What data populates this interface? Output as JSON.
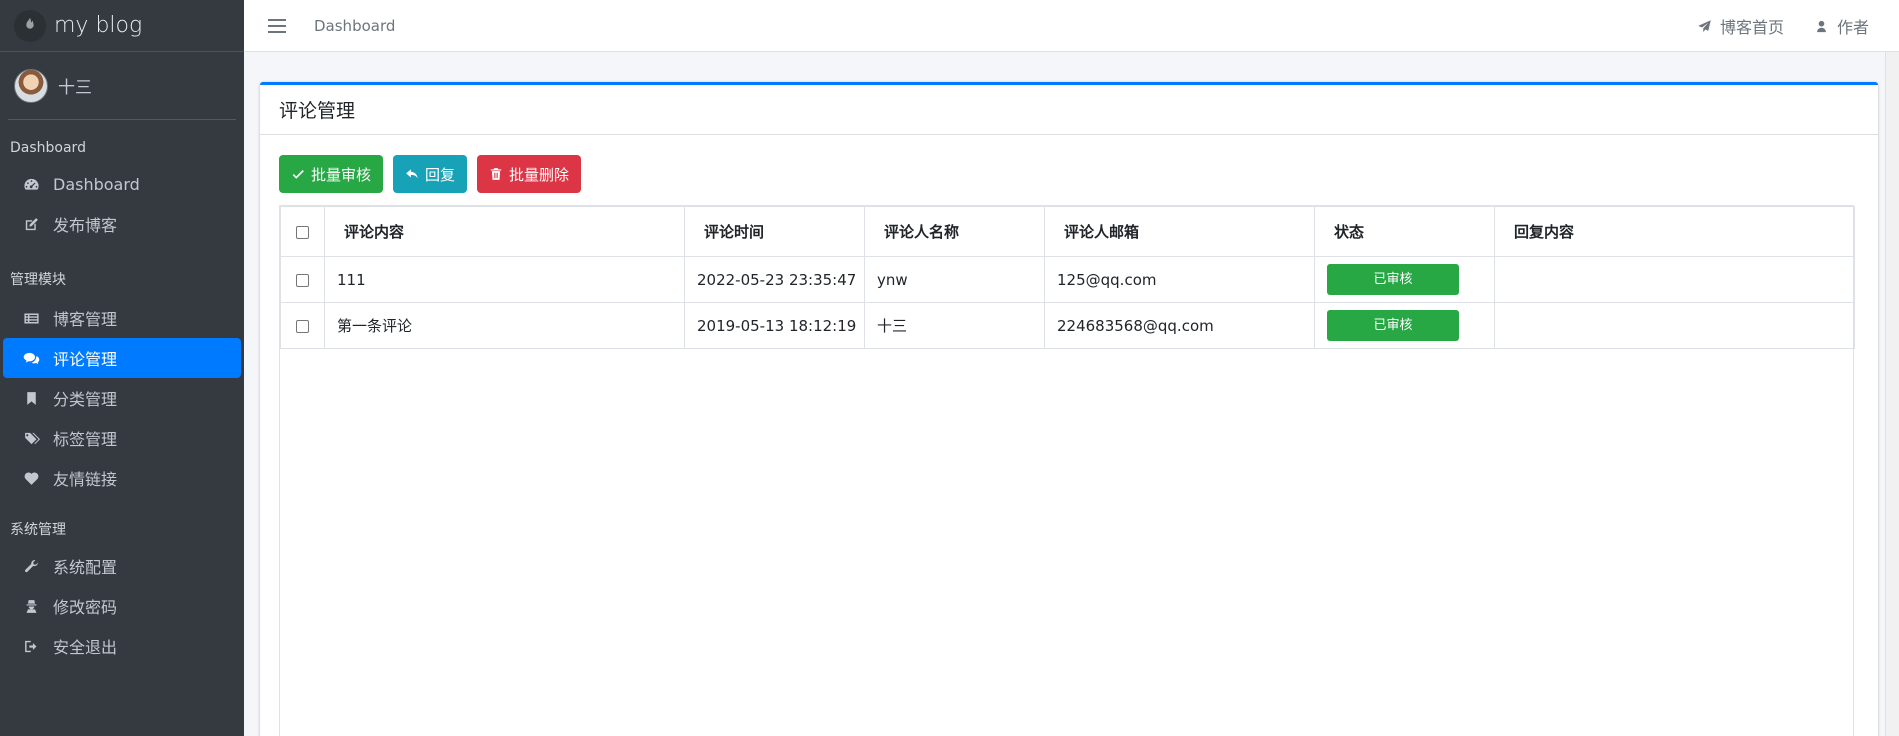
{
  "brand": {
    "name": "my blog"
  },
  "user": {
    "name": "十三"
  },
  "sidebar": {
    "sections": [
      {
        "header": "Dashboard",
        "items": [
          {
            "label": "Dashboard",
            "icon": "dashboard-icon"
          },
          {
            "label": "发布博客",
            "icon": "edit-icon"
          }
        ]
      },
      {
        "header": "管理模块",
        "items": [
          {
            "label": "博客管理",
            "icon": "list-icon"
          },
          {
            "label": "评论管理",
            "icon": "comments-icon",
            "active": true
          },
          {
            "label": "分类管理",
            "icon": "bookmark-icon"
          },
          {
            "label": "标签管理",
            "icon": "tags-icon"
          },
          {
            "label": "友情链接",
            "icon": "heart-icon"
          }
        ]
      },
      {
        "header": "系统管理",
        "items": [
          {
            "label": "系统配置",
            "icon": "wrench-icon"
          },
          {
            "label": "修改密码",
            "icon": "user-secret-icon"
          },
          {
            "label": "安全退出",
            "icon": "sign-out-icon"
          }
        ]
      }
    ]
  },
  "topbar": {
    "breadcrumb": "Dashboard",
    "links": [
      {
        "label": "博客首页",
        "icon": "paper-plane-icon"
      },
      {
        "label": "作者",
        "icon": "user-icon"
      }
    ]
  },
  "card": {
    "title": "评论管理",
    "buttons": {
      "approve": "批量审核",
      "reply": "回复",
      "delete": "批量删除"
    }
  },
  "table": {
    "headers": [
      "评论内容",
      "评论时间",
      "评论人名称",
      "评论人邮箱",
      "状态",
      "回复内容"
    ],
    "rows": [
      {
        "content": "111",
        "time": "2022-05-23 23:35:47",
        "name": "ynw",
        "email": "125@qq.com",
        "status": "已审核",
        "reply": ""
      },
      {
        "content": "第一条评论",
        "time": "2019-05-13 18:12:19",
        "name": "十三",
        "email": "224683568@qq.com",
        "status": "已审核",
        "reply": ""
      }
    ]
  },
  "colors": {
    "sidebar": "#343a40",
    "primary": "#007bff",
    "success": "#28a745",
    "info": "#17a2b8",
    "danger": "#dc3545"
  }
}
